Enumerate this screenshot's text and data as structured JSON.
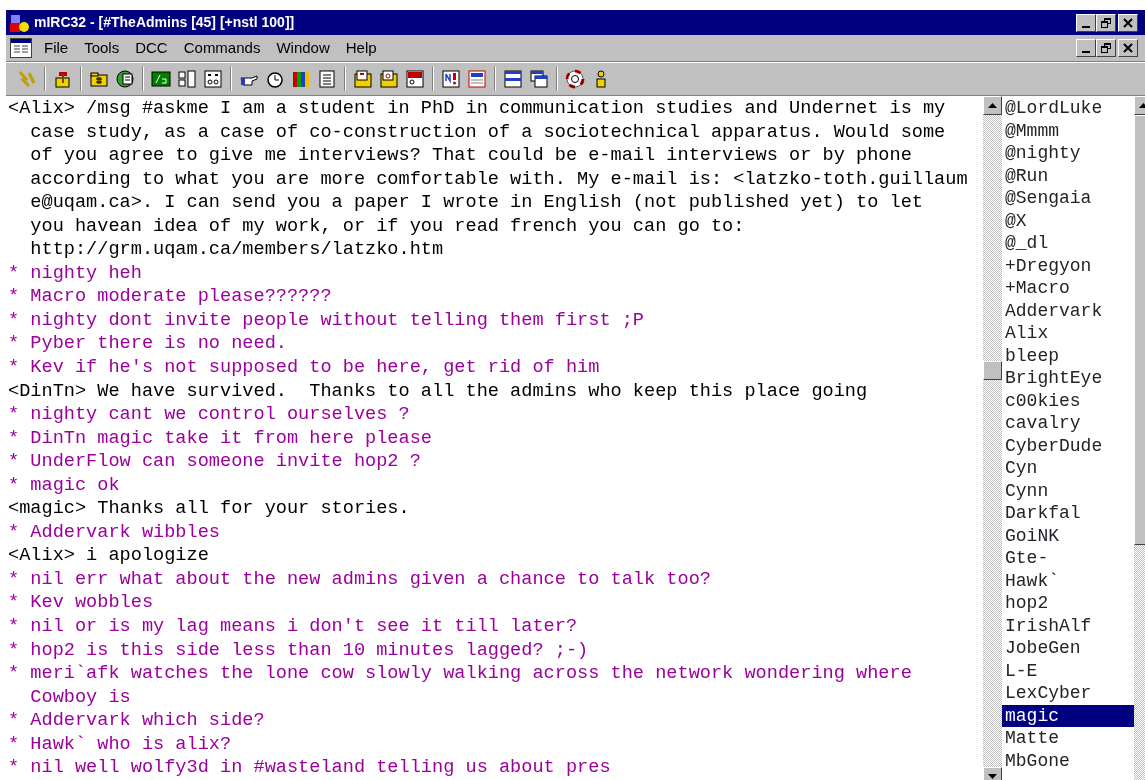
{
  "window": {
    "title": "mIRC32 - [#TheAdmins [45] [+nstl 100]]"
  },
  "menu": [
    "File",
    "Tools",
    "DCC",
    "Commands",
    "Window",
    "Help"
  ],
  "chat": [
    {
      "kind": "message",
      "lines": [
        "<Alix> /msg #askme I am a student in PhD in communication studies and Undernet is my",
        "case study, as a case of co-construction of a sociotechnical apparatus. Would some",
        "of you agree to give me interviews? That could be e-mail interviews or by phone",
        "according to what you are more comfortable with. My e-mail is: <latzko-toth.guillaum",
        "e@uqam.ca>. I can send you a paper I wrote in English (not published yet) to let",
        "you havean idea of my work, or if you read french you can go to:",
        "http://grm.uqam.ca/members/latzko.htm"
      ]
    },
    {
      "kind": "action",
      "lines": [
        "* nighty heh"
      ]
    },
    {
      "kind": "action",
      "lines": [
        "* Macro moderate please??????"
      ]
    },
    {
      "kind": "action",
      "lines": [
        "* nighty dont invite people without telling them first ;P"
      ]
    },
    {
      "kind": "action",
      "lines": [
        "* Pyber there is no need."
      ]
    },
    {
      "kind": "action",
      "lines": [
        "* Kev if he's not supposed to be here, get rid of him"
      ]
    },
    {
      "kind": "message",
      "lines": [
        "<DinTn> We have survived.  Thanks to all the admins who keep this place going"
      ]
    },
    {
      "kind": "action",
      "lines": [
        "* nighty cant we control ourselves ?"
      ]
    },
    {
      "kind": "action",
      "lines": [
        "* DinTn magic take it from here please"
      ]
    },
    {
      "kind": "action",
      "lines": [
        "* UnderFlow can someone invite hop2 ?"
      ]
    },
    {
      "kind": "action",
      "lines": [
        "* magic ok"
      ]
    },
    {
      "kind": "message",
      "lines": [
        "<magic> Thanks all for your stories."
      ]
    },
    {
      "kind": "action",
      "lines": [
        "* Addervark wibbles"
      ]
    },
    {
      "kind": "message",
      "lines": [
        "<Alix> i apologize"
      ]
    },
    {
      "kind": "action",
      "lines": [
        "* nil err what about the new admins given a chance to talk too?"
      ]
    },
    {
      "kind": "action",
      "lines": [
        "* Kev wobbles"
      ]
    },
    {
      "kind": "action",
      "lines": [
        "* nil or is my lag means i don't see it till later?"
      ]
    },
    {
      "kind": "action",
      "lines": [
        "* hop2 is this side less than 10 minutes lagged? ;-)"
      ]
    },
    {
      "kind": "action",
      "lines": [
        "* meri`afk watches the lone cow slowly walking across the network wondering where",
        "Cowboy is"
      ]
    },
    {
      "kind": "action",
      "lines": [
        "* Addervark which side?"
      ]
    },
    {
      "kind": "action",
      "lines": [
        "* Hawk` who is alix?"
      ]
    },
    {
      "kind": "action",
      "lines": [
        "* nil well wolfy3d in #wasteland telling us about pres"
      ]
    }
  ],
  "nicklist": [
    {
      "nick": "@LordLuke",
      "selected": false
    },
    {
      "nick": "@Mmmm",
      "selected": false
    },
    {
      "nick": "@nighty",
      "selected": false
    },
    {
      "nick": "@Run",
      "selected": false
    },
    {
      "nick": "@Sengaia",
      "selected": false
    },
    {
      "nick": "@X",
      "selected": false
    },
    {
      "nick": "@_dl",
      "selected": false
    },
    {
      "nick": "+Dregyon",
      "selected": false
    },
    {
      "nick": "+Macro",
      "selected": false
    },
    {
      "nick": "Addervark",
      "selected": false
    },
    {
      "nick": "Alix",
      "selected": false
    },
    {
      "nick": "bleep",
      "selected": false
    },
    {
      "nick": "BrightEye",
      "selected": false
    },
    {
      "nick": "c00kies",
      "selected": false
    },
    {
      "nick": "cavalry",
      "selected": false
    },
    {
      "nick": "CyberDude",
      "selected": false
    },
    {
      "nick": "Cyn",
      "selected": false
    },
    {
      "nick": "Cynn",
      "selected": false
    },
    {
      "nick": "Darkfal",
      "selected": false
    },
    {
      "nick": "GoiNK",
      "selected": false
    },
    {
      "nick": "Gte-",
      "selected": false
    },
    {
      "nick": "Hawk`",
      "selected": false
    },
    {
      "nick": "hop2",
      "selected": false
    },
    {
      "nick": "IrishAlf",
      "selected": false
    },
    {
      "nick": "JobeGen",
      "selected": false
    },
    {
      "nick": "L-E",
      "selected": false
    },
    {
      "nick": "LexCyber",
      "selected": false
    },
    {
      "nick": "magic",
      "selected": true
    },
    {
      "nick": "Matte",
      "selected": false
    },
    {
      "nick": "MbGone",
      "selected": false
    }
  ]
}
